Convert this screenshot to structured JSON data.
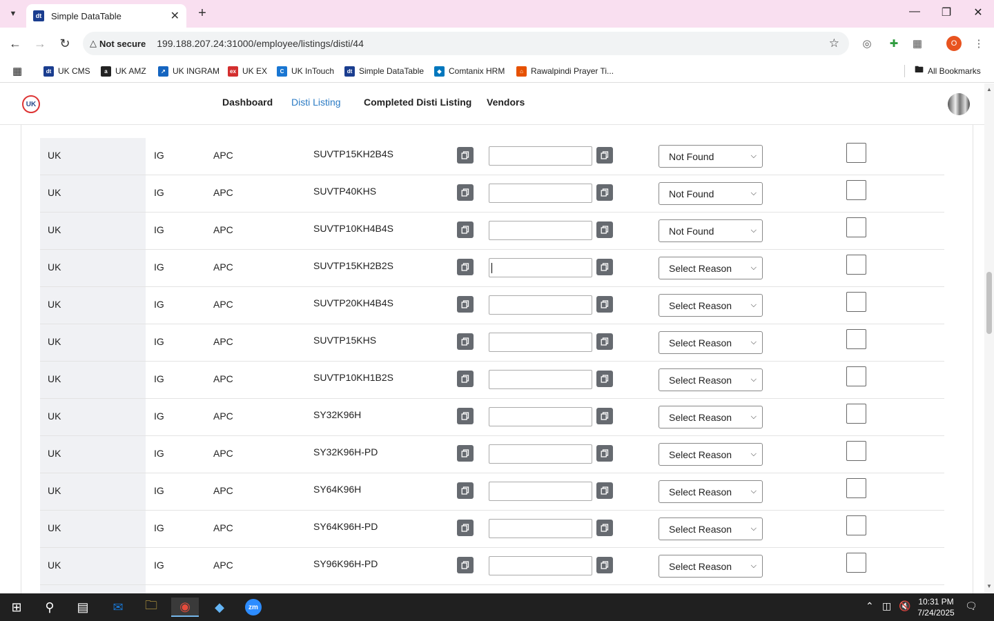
{
  "browser": {
    "tab_title": "Simple DataTable",
    "tab_favicon_text": "dt",
    "security_label": "Not secure",
    "url": "199.188.207.24:31000/employee/listings/disti/44",
    "profile_letter": "O"
  },
  "bookmarks": [
    {
      "label": "UK CMS",
      "icon_color": "#1a3d8f",
      "icon_text": "dt"
    },
    {
      "label": "UK AMZ",
      "icon_color": "#222222",
      "icon_text": "a"
    },
    {
      "label": "UK INGRAM",
      "icon_color": "#1565c0",
      "icon_text": "↗"
    },
    {
      "label": "UK EX",
      "icon_color": "#d32f2f",
      "icon_text": "ex"
    },
    {
      "label": "UK InTouch",
      "icon_color": "#1976d2",
      "icon_text": "C"
    },
    {
      "label": "Simple DataTable",
      "icon_color": "#1a3d8f",
      "icon_text": "dt"
    },
    {
      "label": "Comtanix HRM",
      "icon_color": "#0277bd",
      "icon_text": "◆"
    },
    {
      "label": "Rawalpindi Prayer Ti...",
      "icon_color": "#e65100",
      "icon_text": "⌂"
    }
  ],
  "all_bookmarks_label": "All Bookmarks",
  "nav": {
    "logo_text": "UK",
    "links": [
      "Dashboard",
      "Disti Listing",
      "Completed Disti Listing",
      "Vendors"
    ],
    "active_index": 1
  },
  "rows": [
    {
      "country": "UK",
      "distributor": "IG",
      "vendor": "APC",
      "sku": "SUVTP15KH2B4S",
      "reason": "Not Found"
    },
    {
      "country": "UK",
      "distributor": "IG",
      "vendor": "APC",
      "sku": "SUVTP40KHS",
      "reason": "Not Found"
    },
    {
      "country": "UK",
      "distributor": "IG",
      "vendor": "APC",
      "sku": "SUVTP10KH4B4S",
      "reason": "Not Found"
    },
    {
      "country": "UK",
      "distributor": "IG",
      "vendor": "APC",
      "sku": "SUVTP15KH2B2S",
      "reason": "Select Reason"
    },
    {
      "country": "UK",
      "distributor": "IG",
      "vendor": "APC",
      "sku": "SUVTP20KH4B4S",
      "reason": "Select Reason"
    },
    {
      "country": "UK",
      "distributor": "IG",
      "vendor": "APC",
      "sku": "SUVTP15KHS",
      "reason": "Select Reason"
    },
    {
      "country": "UK",
      "distributor": "IG",
      "vendor": "APC",
      "sku": "SUVTP10KH1B2S",
      "reason": "Select Reason"
    },
    {
      "country": "UK",
      "distributor": "IG",
      "vendor": "APC",
      "sku": "SY32K96H",
      "reason": "Select Reason"
    },
    {
      "country": "UK",
      "distributor": "IG",
      "vendor": "APC",
      "sku": "SY32K96H-PD",
      "reason": "Select Reason"
    },
    {
      "country": "UK",
      "distributor": "IG",
      "vendor": "APC",
      "sku": "SY64K96H",
      "reason": "Select Reason"
    },
    {
      "country": "UK",
      "distributor": "IG",
      "vendor": "APC",
      "sku": "SY64K96H-PD",
      "reason": "Select Reason"
    },
    {
      "country": "UK",
      "distributor": "IG",
      "vendor": "APC",
      "sku": "SY96K96H-PD",
      "reason": "Select Reason"
    }
  ],
  "focused_row_index": 3,
  "taskbar": {
    "time": "10:31 PM",
    "date": "7/24/2025"
  },
  "colors": {
    "active_link": "#2b7bc4",
    "tab_strip": "#f9dff0",
    "copy_button": "#666a70"
  }
}
